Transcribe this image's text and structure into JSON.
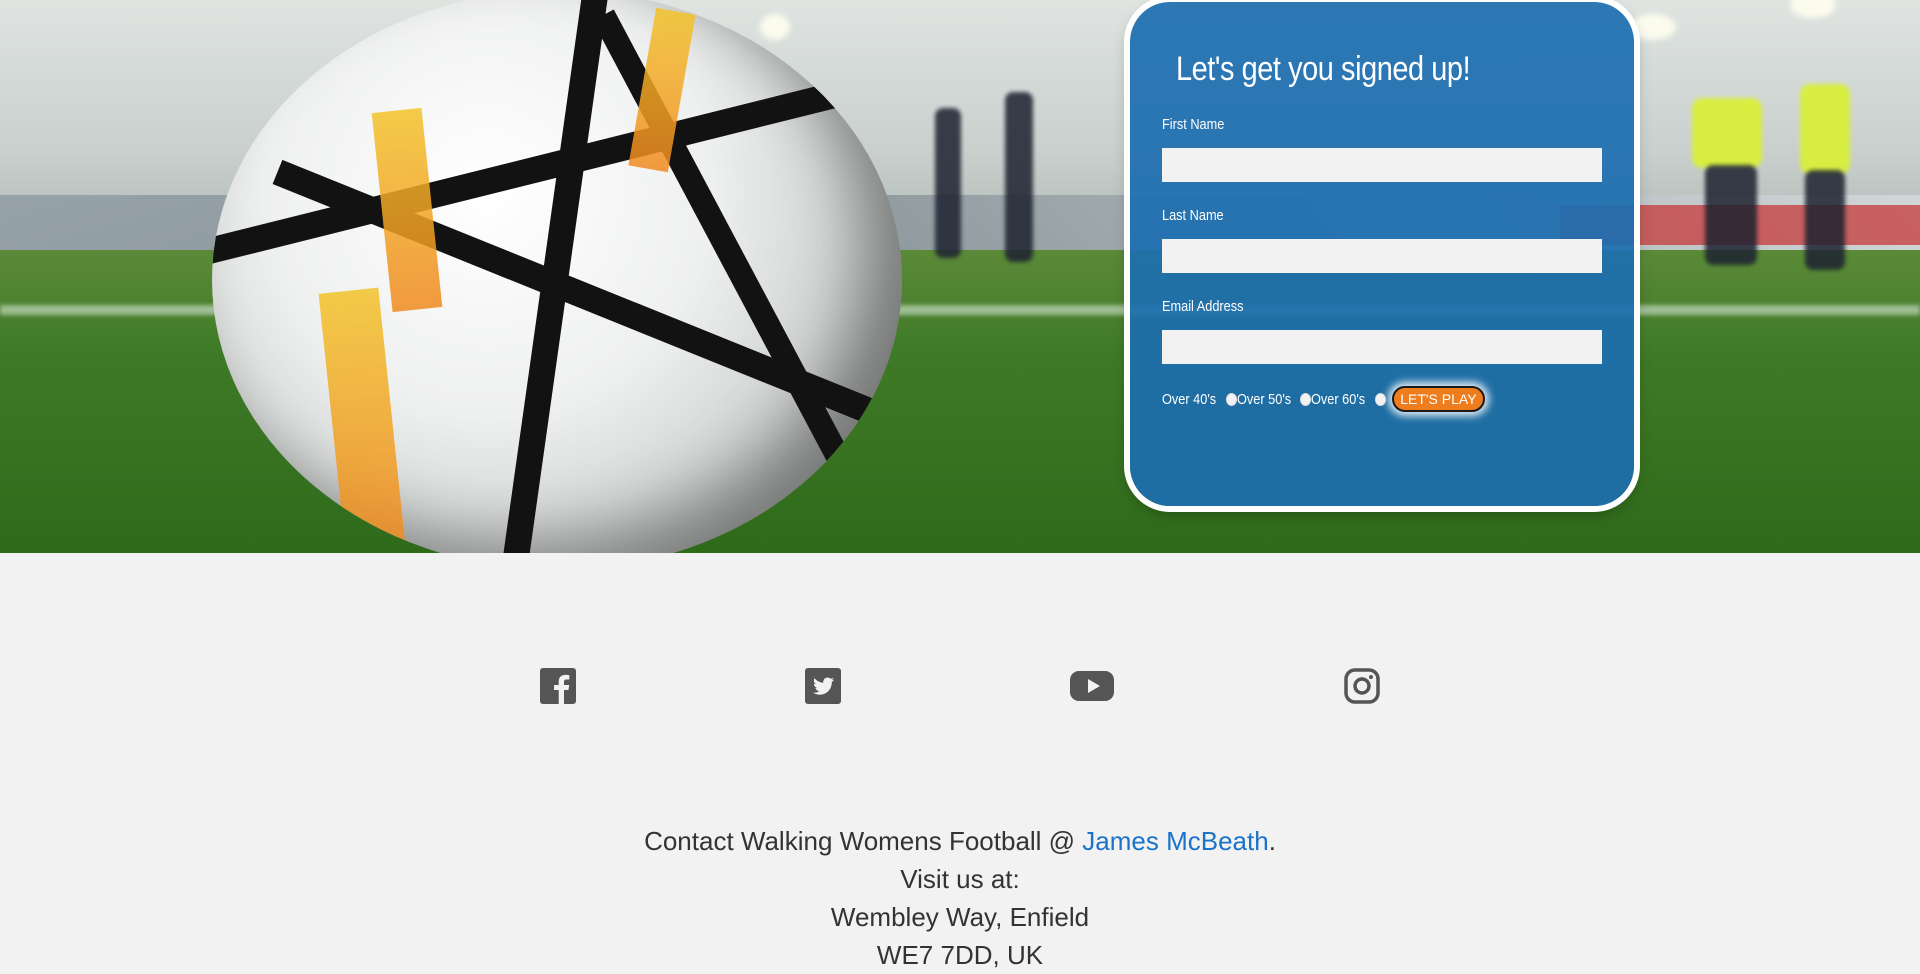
{
  "signup": {
    "title": "Let's get you signed up!",
    "first_name_label": "First Name",
    "first_name_value": "",
    "last_name_label": "Last Name",
    "last_name_value": "",
    "email_label": "Email Address",
    "email_value": "",
    "age_options": [
      "Over 40's",
      "Over 50's",
      "Over 60's"
    ],
    "submit_label": "LET'S PLAY"
  },
  "social": {
    "icons": [
      "facebook-icon",
      "twitter-icon",
      "youtube-icon",
      "instagram-icon"
    ]
  },
  "footer": {
    "contact_prefix": "Contact Walking Womens Football @ ",
    "contact_link": "James McBeath",
    "contact_suffix": ".",
    "visit_label": "Visit us at:",
    "address_line1": "Wembley Way, Enfield",
    "address_line2": "WE7 7DD, UK"
  },
  "colors": {
    "card_blue": "#1c6eb0",
    "button_orange": "#ef7d1e",
    "link_blue": "#1a73c8",
    "icon_gray": "#555555",
    "page_background": "#f2f2f2"
  }
}
